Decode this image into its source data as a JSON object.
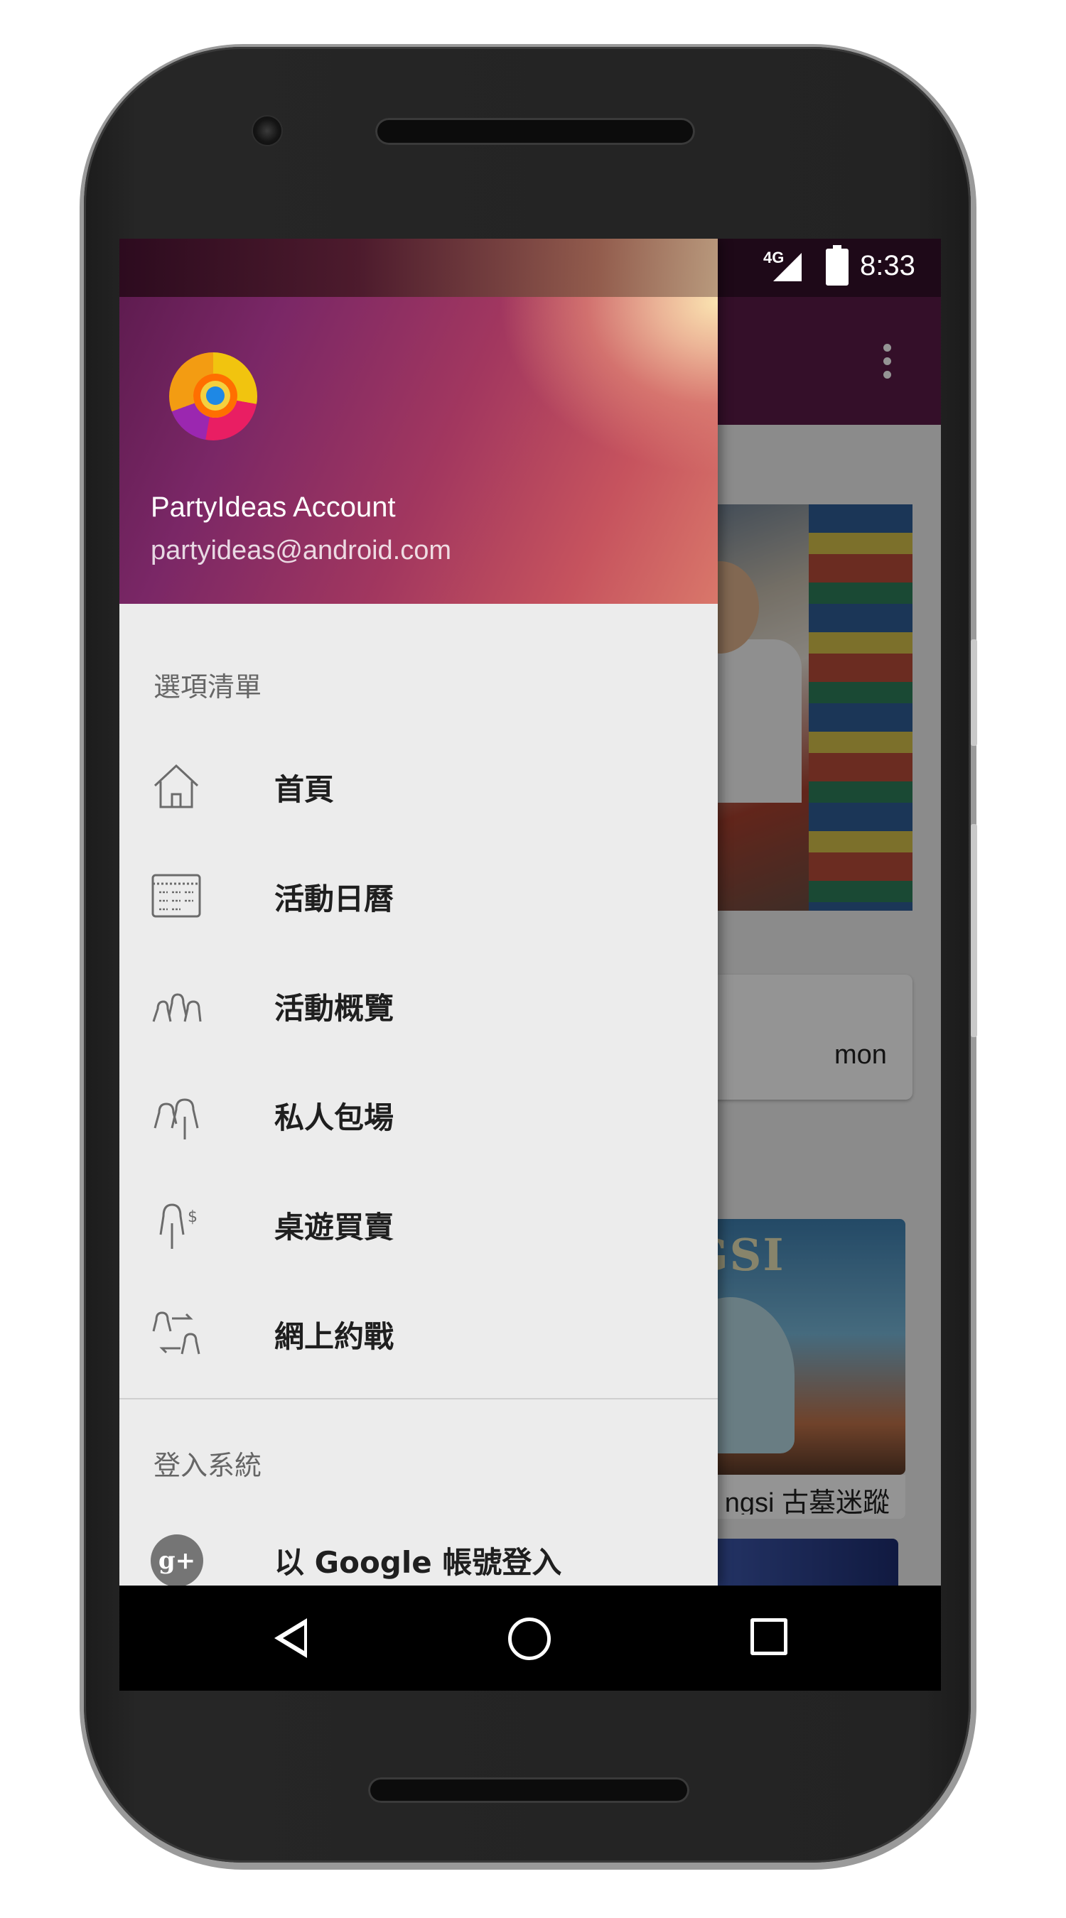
{
  "status_bar": {
    "network": "4G",
    "time": "8:33"
  },
  "app_background": {
    "card_text": "mon",
    "game_title": "GANGSI",
    "caption": "ngsi 古墓迷蹤"
  },
  "drawer": {
    "account": {
      "name": "PartyIdeas Account",
      "email": "partyideas@android.com"
    },
    "menu_section_label": "選項清單",
    "menu_items": [
      {
        "label": "首頁",
        "icon": "home-icon"
      },
      {
        "label": "活動日曆",
        "icon": "calendar-icon"
      },
      {
        "label": "活動概覽",
        "icon": "group-icon"
      },
      {
        "label": "私人包場",
        "icon": "private-room-icon"
      },
      {
        "label": "桌遊買賣",
        "icon": "trade-icon"
      },
      {
        "label": "網上約戰",
        "icon": "online-match-icon"
      }
    ],
    "login_section_label": "登入系統",
    "login_items": [
      {
        "label": "以 Google 帳號登入",
        "icon": "google-plus-icon"
      }
    ]
  },
  "colors": {
    "toolbar": "#5a1a48",
    "drawer_bg": "#ececec",
    "header_start": "#5a1a4c",
    "header_end": "#f7d9a6"
  }
}
